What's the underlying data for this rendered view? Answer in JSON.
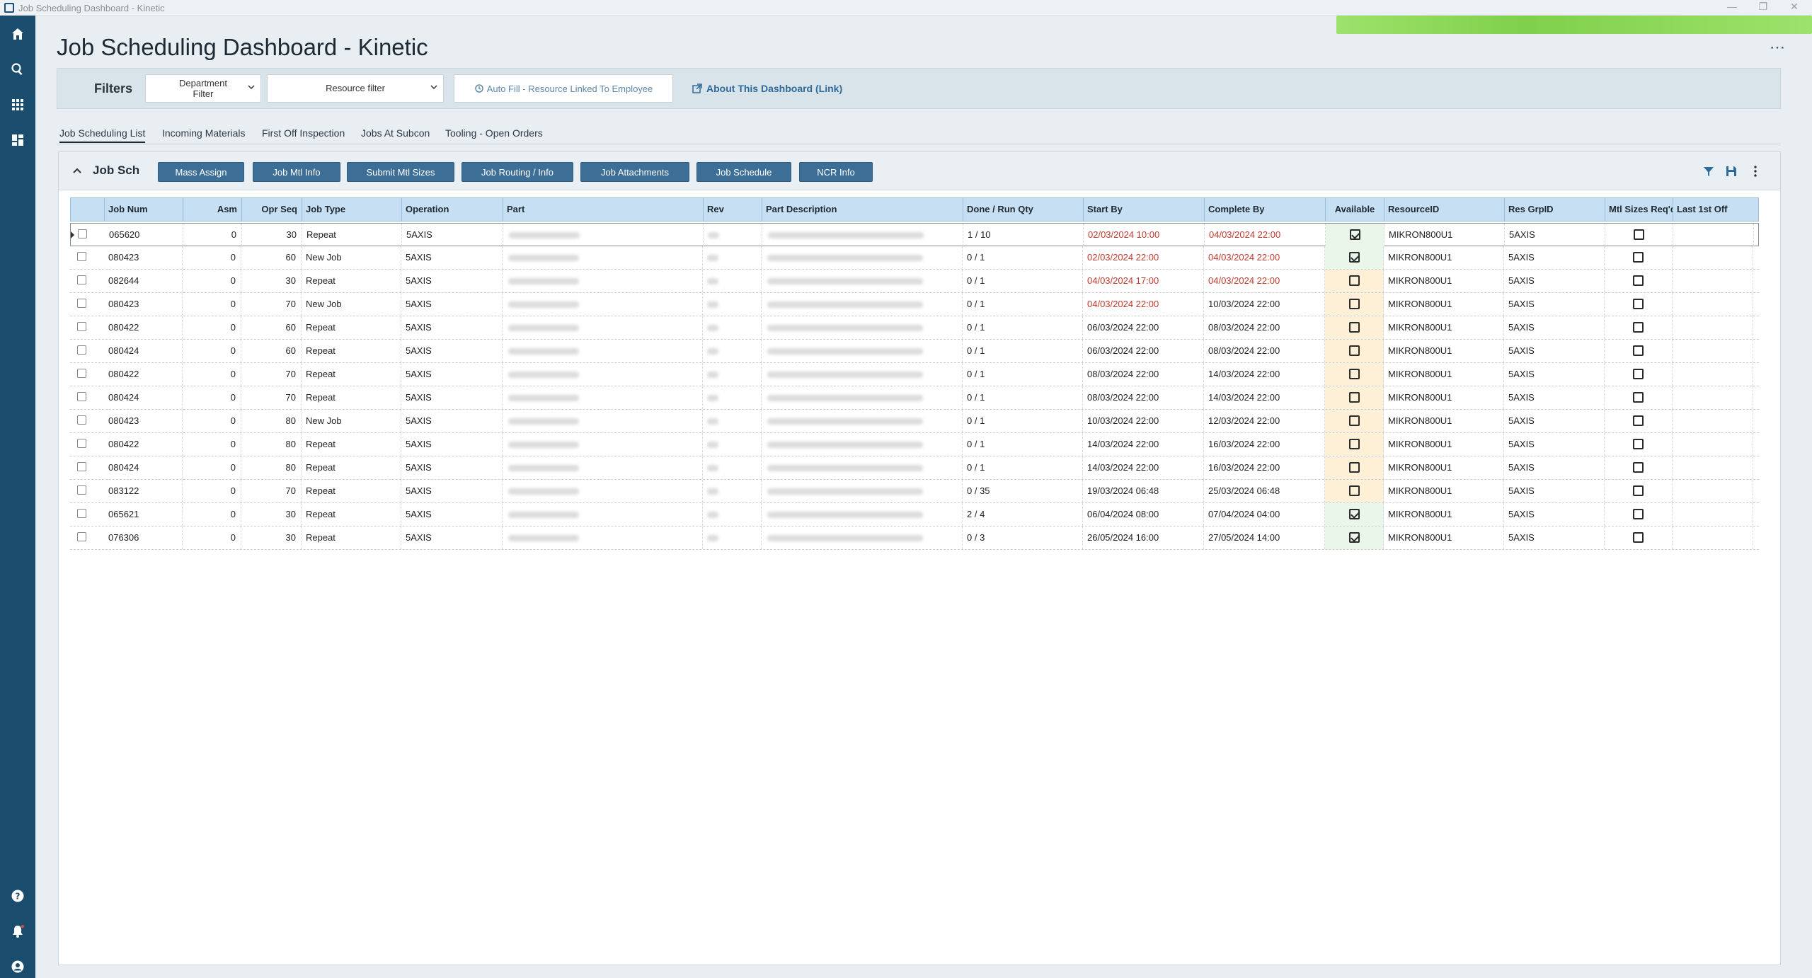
{
  "window": {
    "title": "Job Scheduling Dashboard - Kinetic"
  },
  "page": {
    "title": "Job Scheduling Dashboard - Kinetic"
  },
  "filters": {
    "label": "Filters",
    "department_line1": "Department",
    "department_line2": "Filter",
    "resource": "Resource filter",
    "autofill": "Auto Fill - Resource Linked To Employee",
    "about": "About This Dashboard (Link)"
  },
  "tabs": [
    "Job Scheduling List",
    "Incoming Materials",
    "First Off Inspection",
    "Jobs At Subcon",
    "Tooling - Open Orders"
  ],
  "panel": {
    "title": "Job Sch",
    "buttons": [
      "Mass Assign",
      "Job Mtl Info",
      "Submit Mtl Sizes",
      "Job Routing / Info",
      "Job Attachments",
      "Job Schedule",
      "NCR Info"
    ]
  },
  "columns": [
    "Job Num",
    "Asm",
    "Opr Seq",
    "Job Type",
    "Operation",
    "Part",
    "Rev",
    "Part Description",
    "Done / Run Qty",
    "Start By",
    "Complete By",
    "Available",
    "ResourceID",
    "Res GrpID",
    "Mtl Sizes Req'd",
    "Last 1st Off"
  ],
  "rows": [
    {
      "job": "065620",
      "asm": "0",
      "seq": "30",
      "type": "Repeat",
      "op": "5AXIS",
      "qty": "1 / 10",
      "start": "02/03/2024 10:00",
      "start_red": true,
      "complete": "04/03/2024 22:00",
      "complete_red": true,
      "available": true,
      "resource": "MIKRON800U1",
      "grp": "5AXIS",
      "mtl": false
    },
    {
      "job": "080423",
      "asm": "0",
      "seq": "60",
      "type": "New Job",
      "op": "5AXIS",
      "qty": "0 / 1",
      "start": "02/03/2024 22:00",
      "start_red": true,
      "complete": "04/03/2024 22:00",
      "complete_red": true,
      "available": true,
      "resource": "MIKRON800U1",
      "grp": "5AXIS",
      "mtl": false
    },
    {
      "job": "082644",
      "asm": "0",
      "seq": "30",
      "type": "Repeat",
      "op": "5AXIS",
      "qty": "0 / 1",
      "start": "04/03/2024 17:00",
      "start_red": true,
      "complete": "04/03/2024 22:00",
      "complete_red": true,
      "available": false,
      "resource": "MIKRON800U1",
      "grp": "5AXIS",
      "mtl": false
    },
    {
      "job": "080423",
      "asm": "0",
      "seq": "70",
      "type": "New Job",
      "op": "5AXIS",
      "qty": "0 / 1",
      "start": "04/03/2024 22:00",
      "start_red": true,
      "complete": "10/03/2024 22:00",
      "complete_red": false,
      "available": false,
      "resource": "MIKRON800U1",
      "grp": "5AXIS",
      "mtl": false
    },
    {
      "job": "080422",
      "asm": "0",
      "seq": "60",
      "type": "Repeat",
      "op": "5AXIS",
      "qty": "0 / 1",
      "start": "06/03/2024 22:00",
      "start_red": false,
      "complete": "08/03/2024 22:00",
      "complete_red": false,
      "available": false,
      "resource": "MIKRON800U1",
      "grp": "5AXIS",
      "mtl": false
    },
    {
      "job": "080424",
      "asm": "0",
      "seq": "60",
      "type": "Repeat",
      "op": "5AXIS",
      "qty": "0 / 1",
      "start": "06/03/2024 22:00",
      "start_red": false,
      "complete": "08/03/2024 22:00",
      "complete_red": false,
      "available": false,
      "resource": "MIKRON800U1",
      "grp": "5AXIS",
      "mtl": false
    },
    {
      "job": "080422",
      "asm": "0",
      "seq": "70",
      "type": "Repeat",
      "op": "5AXIS",
      "qty": "0 / 1",
      "start": "08/03/2024 22:00",
      "start_red": false,
      "complete": "14/03/2024 22:00",
      "complete_red": false,
      "available": false,
      "resource": "MIKRON800U1",
      "grp": "5AXIS",
      "mtl": false
    },
    {
      "job": "080424",
      "asm": "0",
      "seq": "70",
      "type": "Repeat",
      "op": "5AXIS",
      "qty": "0 / 1",
      "start": "08/03/2024 22:00",
      "start_red": false,
      "complete": "14/03/2024 22:00",
      "complete_red": false,
      "available": false,
      "resource": "MIKRON800U1",
      "grp": "5AXIS",
      "mtl": false
    },
    {
      "job": "080423",
      "asm": "0",
      "seq": "80",
      "type": "New Job",
      "op": "5AXIS",
      "qty": "0 / 1",
      "start": "10/03/2024 22:00",
      "start_red": false,
      "complete": "12/03/2024 22:00",
      "complete_red": false,
      "available": false,
      "resource": "MIKRON800U1",
      "grp": "5AXIS",
      "mtl": false
    },
    {
      "job": "080422",
      "asm": "0",
      "seq": "80",
      "type": "Repeat",
      "op": "5AXIS",
      "qty": "0 / 1",
      "start": "14/03/2024 22:00",
      "start_red": false,
      "complete": "16/03/2024 22:00",
      "complete_red": false,
      "available": false,
      "resource": "MIKRON800U1",
      "grp": "5AXIS",
      "mtl": false
    },
    {
      "job": "080424",
      "asm": "0",
      "seq": "80",
      "type": "Repeat",
      "op": "5AXIS",
      "qty": "0 / 1",
      "start": "14/03/2024 22:00",
      "start_red": false,
      "complete": "16/03/2024 22:00",
      "complete_red": false,
      "available": false,
      "resource": "MIKRON800U1",
      "grp": "5AXIS",
      "mtl": false
    },
    {
      "job": "083122",
      "asm": "0",
      "seq": "70",
      "type": "Repeat",
      "op": "5AXIS",
      "qty": "0 / 35",
      "start": "19/03/2024 06:48",
      "start_red": false,
      "complete": "25/03/2024 06:48",
      "complete_red": false,
      "available": false,
      "resource": "MIKRON800U1",
      "grp": "5AXIS",
      "mtl": false
    },
    {
      "job": "065621",
      "asm": "0",
      "seq": "30",
      "type": "Repeat",
      "op": "5AXIS",
      "qty": "2 / 4",
      "start": "06/04/2024 08:00",
      "start_red": false,
      "complete": "07/04/2024 04:00",
      "complete_red": false,
      "available": true,
      "resource": "MIKRON800U1",
      "grp": "5AXIS",
      "mtl": false
    },
    {
      "job": "076306",
      "asm": "0",
      "seq": "30",
      "type": "Repeat",
      "op": "5AXIS",
      "qty": "0 / 3",
      "start": "26/05/2024 16:00",
      "start_red": false,
      "complete": "27/05/2024 14:00",
      "complete_red": false,
      "available": true,
      "resource": "MIKRON800U1",
      "grp": "5AXIS",
      "mtl": false
    }
  ],
  "colors": {
    "sidebar": "#1a4d6d",
    "button": "#3d6e96",
    "header": "#c7dff2",
    "late": "#c0392b",
    "available_pending": "#fdf0d7",
    "available_ok": "#eaf6ea"
  }
}
